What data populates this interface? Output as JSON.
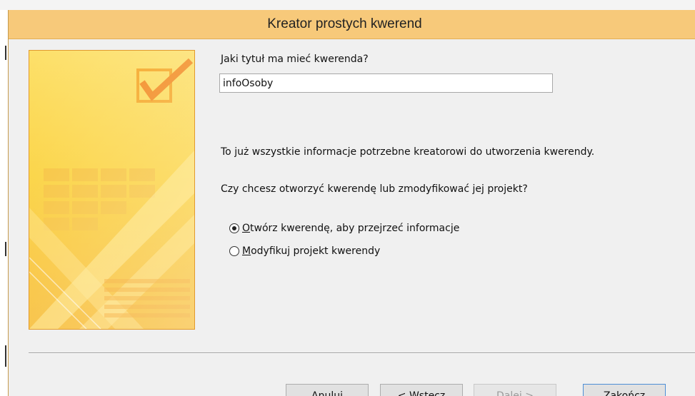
{
  "dialog": {
    "title": "Kreator prostych kwerend"
  },
  "form": {
    "question_title": "Jaki tytuł ma mieć kwerenda?",
    "title_value": "infoOsoby",
    "info_text": "To już wszystkie informacje potrzebne kreatorowi do utworzenia kwerendy.",
    "choice_question": "Czy chcesz otworzyć kwerendę lub zmodyfikować jej projekt?",
    "options": [
      {
        "key": "O",
        "rest": "twórz kwerendę, aby przejrzeć informacje",
        "selected": true
      },
      {
        "key": "M",
        "rest": "odyfikuj projekt kwerendy",
        "selected": false
      }
    ]
  },
  "buttons": {
    "cancel": "Anuluj",
    "back_prefix": "< ",
    "back_key": "W",
    "back_rest": "stecz",
    "next_key": "D",
    "next_rest": "alej >",
    "finish_pre": "Zak",
    "finish_key": "o",
    "finish_post": "ńcz"
  },
  "colors": {
    "titlebar": "#f7c97a",
    "art_yellow": "#fbd23c",
    "art_orange": "#f5a623",
    "art_border": "#e29a2e"
  },
  "icons": {
    "wizard_art": "checkbox-check-icon"
  }
}
